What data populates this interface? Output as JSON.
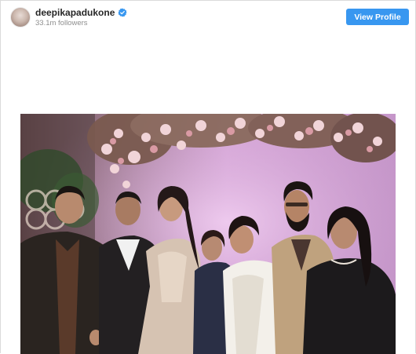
{
  "profile": {
    "username": "deepikapadukone",
    "followers": "33.1m followers",
    "verified": true,
    "view_profile_label": "View Profile"
  },
  "icons": {
    "verified": "verified-badge-icon"
  },
  "colors": {
    "button": "#3897f0",
    "username": "#262626",
    "muted": "#8e8e8e",
    "backdrop": "#d8a6d6"
  }
}
